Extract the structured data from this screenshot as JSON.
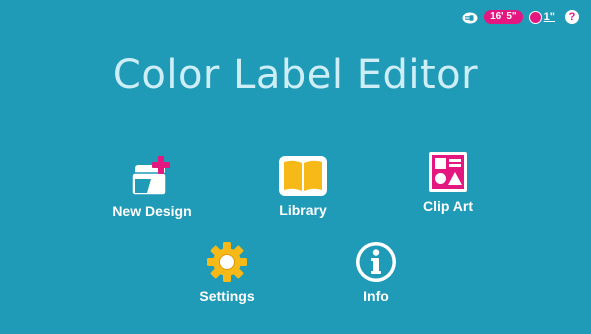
{
  "app": {
    "title": "Color Label Editor",
    "background_color": "#1f9ab7",
    "accent_color": "#e4167f",
    "icon_color": "#f6b918"
  },
  "status": {
    "power_icon": "power-plug-icon",
    "tape_length": "16' 5\"",
    "tape_width": "1\"",
    "help_icon": "help-icon",
    "help_symbol": "?"
  },
  "menu": {
    "new_design": {
      "label": "New Design",
      "icon": "new-design-icon"
    },
    "library": {
      "label": "Library",
      "icon": "book-icon"
    },
    "clip_art": {
      "label": "Clip Art",
      "icon": "clip-art-icon"
    },
    "settings": {
      "label": "Settings",
      "icon": "gear-icon"
    },
    "info": {
      "label": "Info",
      "icon": "info-icon"
    }
  }
}
